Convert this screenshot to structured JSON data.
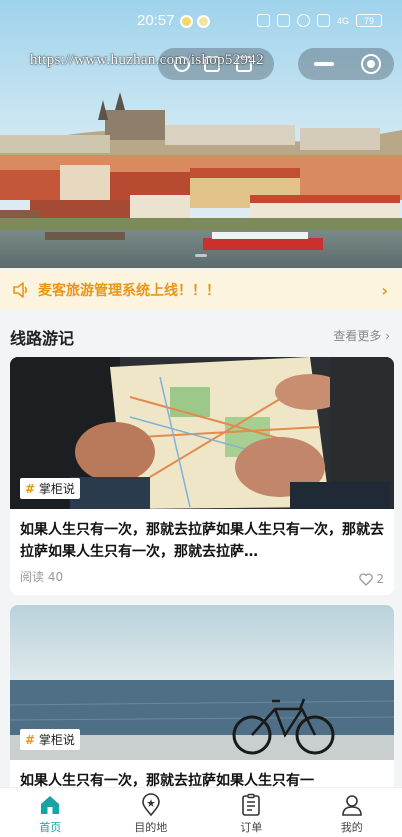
{
  "status_bar": {
    "time": "20:57",
    "battery": "79",
    "signal": "4G"
  },
  "watermark": "https://www.huzhan.com/ishop52942",
  "notice": {
    "text": "麦客旅游管理系统上线！！！"
  },
  "section": {
    "title": "线路游记",
    "more": "查看更多 ›"
  },
  "cards": [
    {
      "tag": "掌柜说",
      "title": "如果人生只有一次，那就去拉萨如果人生只有一次，那就去拉萨如果人生只有一次，那就去拉萨…",
      "reads": "阅读 40",
      "likes": "2"
    },
    {
      "tag": "掌柜说",
      "title": "如果人生只有一次，那就去拉萨如果人生只有一"
    }
  ],
  "tabbar": [
    {
      "label": "首页",
      "icon": "home-icon",
      "active": true
    },
    {
      "label": "目的地",
      "icon": "location-icon",
      "active": false
    },
    {
      "label": "订单",
      "icon": "order-icon",
      "active": false
    },
    {
      "label": "我的",
      "icon": "user-icon",
      "active": false
    }
  ],
  "colors": {
    "accent": "#1aa3a3",
    "notice": "#e8961a",
    "notice_bg": "#fcf4de"
  }
}
